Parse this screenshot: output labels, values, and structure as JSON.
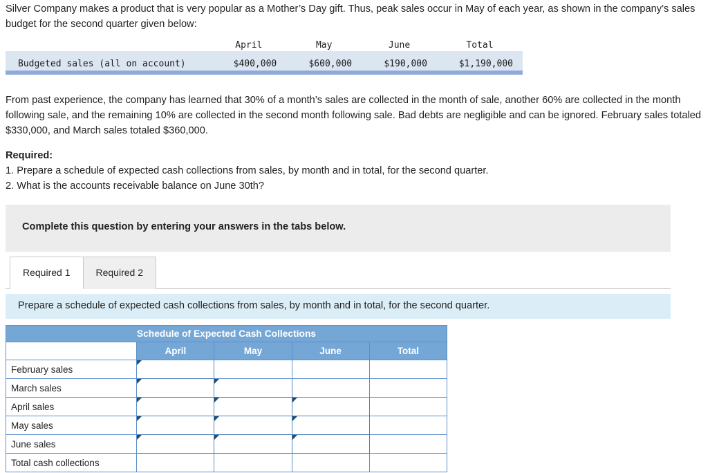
{
  "intro": {
    "text": "Silver Company makes a product that is very popular as a Mother’s Day gift. Thus, peak sales occur in May of each year, as shown in the company’s sales budget for the second quarter given below:"
  },
  "budget_table": {
    "headers": [
      "",
      "April",
      "May",
      "June",
      "Total"
    ],
    "row_label": "Budgeted sales (all on account)",
    "values": [
      "$400,000",
      "$600,000",
      "$190,000",
      "$1,190,000"
    ]
  },
  "paragraph2": {
    "text": "From past experience, the company has learned that 30% of a month’s sales are collected in the month of sale, another 60% are collected in the month following sale, and the remaining 10% are collected in the second month following sale. Bad debts are negligible and can be ignored. February sales totaled $330,000, and March sales totaled $360,000."
  },
  "required": {
    "title": "Required:",
    "item1": "1. Prepare a schedule of expected cash collections from sales, by month and in total, for the second quarter.",
    "item2": "2. What is the accounts receivable balance on June 30th?"
  },
  "complete_banner": {
    "text": "Complete this question by entering your answers in the tabs below."
  },
  "tabs": [
    {
      "label": "Required 1",
      "active": true
    },
    {
      "label": "Required 2",
      "active": false
    }
  ],
  "tab_instruction": {
    "text": "Prepare a schedule of expected cash collections from sales, by month and in total, for the second quarter."
  },
  "schedule": {
    "title": "Schedule of Expected Cash Collections",
    "headers": [
      "",
      "April",
      "May",
      "June",
      "Total"
    ],
    "rows": [
      {
        "label": "February sales",
        "cells": [
          "input",
          "empty",
          "empty",
          "plain"
        ]
      },
      {
        "label": "March sales",
        "cells": [
          "input",
          "input",
          "empty",
          "plain"
        ]
      },
      {
        "label": "April sales",
        "cells": [
          "input",
          "input",
          "input",
          "plain"
        ]
      },
      {
        "label": "May sales",
        "cells": [
          "input",
          "input",
          "input",
          "plain"
        ]
      },
      {
        "label": "June sales",
        "cells": [
          "input",
          "input",
          "input",
          "plain"
        ]
      },
      {
        "label": "Total cash collections",
        "cells": [
          "plain",
          "plain",
          "plain",
          "plain"
        ]
      }
    ]
  },
  "colors": {
    "table_header_blue": "#74a6d6",
    "budget_band": "#dce6f1",
    "budget_rule": "#8eaadb",
    "instruction_bg": "#dbeef7",
    "banner_bg": "#ececec",
    "cell_border": "#4a7fb5"
  }
}
